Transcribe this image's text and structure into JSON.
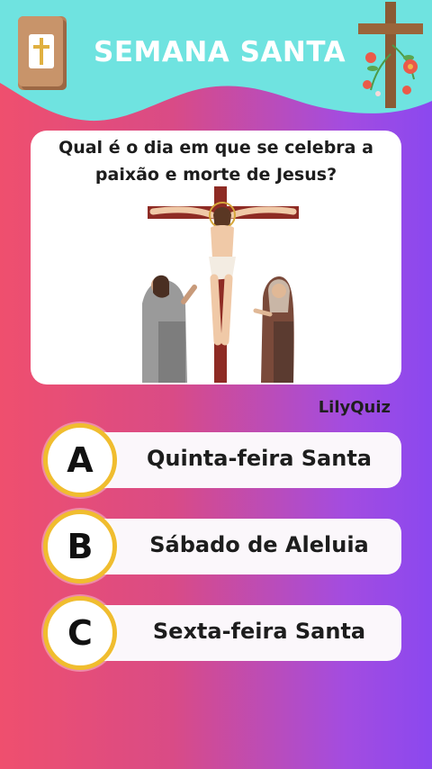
{
  "header": {
    "title": "SEMANA SANTA",
    "banner_color": "#6fe3e0",
    "bible_icon": "bible-book-icon",
    "cross_icon": "wooden-cross-with-flowers-icon"
  },
  "question": {
    "text_line1": "Qual é o dia em que se celebra a",
    "text_line2": "paixão e morte de Jesus?",
    "illustration": "crucifixion-scene"
  },
  "brand": "LilyQuiz",
  "answers": [
    {
      "letter": "A",
      "label": "Quinta-feira Santa"
    },
    {
      "letter": "B",
      "label": "Sábado de Aleluia"
    },
    {
      "letter": "C",
      "label": "Sexta-feira Santa"
    }
  ],
  "colors": {
    "badge_border": "#f0bd2f",
    "background_left": "#ef4f6e",
    "background_right": "#8b48ef"
  }
}
